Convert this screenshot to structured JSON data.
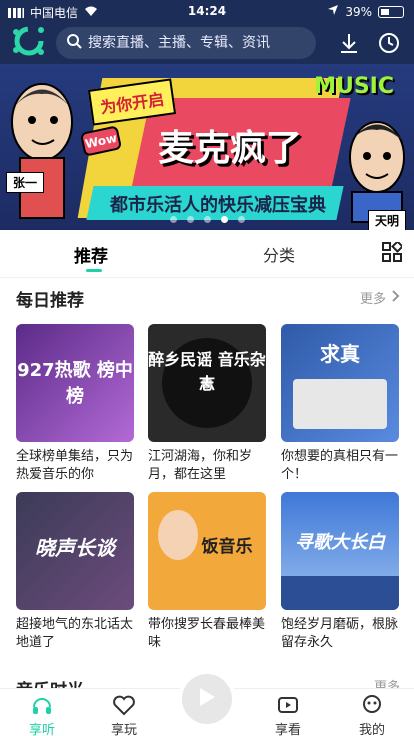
{
  "status": {
    "carrier": "中国电信",
    "time": "14:24",
    "battery": "39%"
  },
  "search": {
    "placeholder": "搜索直播、主播、专辑、资讯"
  },
  "banner": {
    "tag": "为你开启",
    "wow": "Wow",
    "title": "麦克疯了",
    "slogan": "都市乐活人的快乐减压宝典",
    "music": "MUSIC",
    "left_name": "张一",
    "right_name": "天明",
    "dot_count": 5,
    "active_dot": 3
  },
  "tabs": [
    {
      "label": "推荐",
      "active": true
    },
    {
      "label": "分类",
      "active": false
    }
  ],
  "daily": {
    "title": "每日推荐",
    "more": "更多",
    "items": [
      {
        "cover": "927热歌 榜中榜",
        "caption": "全球榜单集结，只为热爱音乐的你"
      },
      {
        "cover": "醉乡民谣 音乐杂志",
        "caption": "江河湖海，你和岁月，都在这里"
      },
      {
        "cover": "求真",
        "caption": "你想要的真相只有一个！"
      },
      {
        "cover": "晓声长谈",
        "caption": "超接地气的东北话太地道了"
      },
      {
        "cover": "饭音乐",
        "caption": "带你搜罗长春最棒美味"
      },
      {
        "cover": "寻歌大长白",
        "caption": "饱经岁月磨砺，根脉留存永久"
      }
    ]
  },
  "next_section": {
    "title": "音乐时光",
    "more": "更多"
  },
  "bottom_nav": [
    {
      "label": "享听",
      "active": true
    },
    {
      "label": "享玩",
      "active": false
    },
    {
      "label": "享看",
      "active": false
    },
    {
      "label": "我的",
      "active": false
    }
  ],
  "colors": {
    "accent": "#1fd1a5",
    "header": "#1c2d57"
  }
}
